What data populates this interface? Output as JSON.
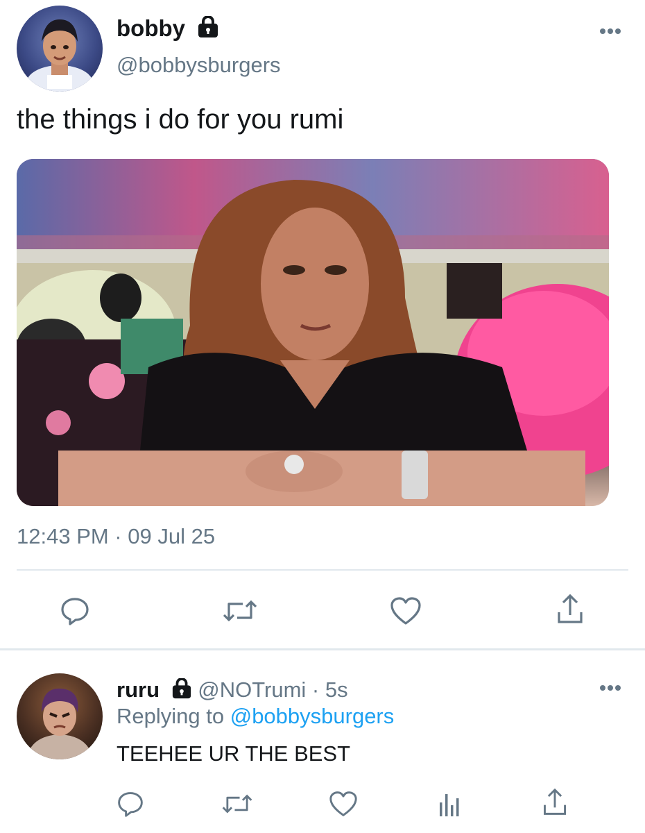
{
  "tweet": {
    "author_name": "bobby",
    "author_handle": "@bobbysburgers",
    "text": "the things i do for you rumi",
    "timestamp": "12:43 PM · 09 Jul 25",
    "media_alt": "photo of a woman leaning on a desk in front of a pink fluffy pillow",
    "actions": [
      "reply-icon",
      "retweet-icon",
      "like-icon",
      "share-icon"
    ]
  },
  "reply": {
    "author_name": "ruru",
    "author_handle": "@NOTrumi",
    "separator": "·",
    "time_ago": "5s",
    "replying_prefix": "Replying to",
    "replying_to": "@bobbysburgers",
    "text": "TEEHEE UR THE BEST",
    "actions": [
      "reply-icon",
      "retweet-icon",
      "like-icon",
      "analytics-icon",
      "share-icon"
    ]
  },
  "colors": {
    "text_primary": "#14171a",
    "text_secondary": "#657786",
    "link": "#1da1f2",
    "divider": "#e1e8ed"
  }
}
